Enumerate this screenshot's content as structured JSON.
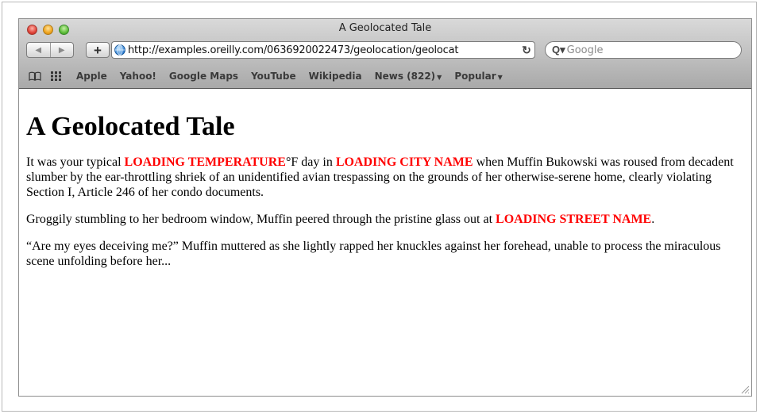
{
  "window": {
    "title": "A Geolocated Tale"
  },
  "toolbar": {
    "back_label": "◀",
    "forward_label": "▶",
    "add_bookmark_label": "+",
    "address_url": "http://examples.oreilly.com/0636920022473/geolocation/geolocat",
    "reload_label": "↻",
    "search_icon_label": "Q▾",
    "search_placeholder": "Google"
  },
  "bookmarks": {
    "items": [
      {
        "label": "Apple"
      },
      {
        "label": "Yahoo!"
      },
      {
        "label": "Google Maps"
      },
      {
        "label": "YouTube"
      },
      {
        "label": "Wikipedia"
      },
      {
        "label": "News (822)"
      },
      {
        "label": "Popular"
      }
    ]
  },
  "page": {
    "heading": "A Geolocated Tale",
    "p1": {
      "t1": "It was your typical ",
      "temp": "LOADING TEMPERATURE",
      "t2": "°F day in ",
      "city": "LOADING CITY NAME",
      "t3": " when Muffin Bukowski was roused from decadent slumber by the ear-throttling shriek of an unidentified avian trespassing on the grounds of her otherwise-serene home, clearly violating Section I, Article 246 of her condo documents."
    },
    "p2": {
      "t1": "Groggily stumbling to her bedroom window, Muffin peered through the pristine glass out at ",
      "street": "LOADING STREET NAME",
      "t2": "."
    },
    "p3": {
      "t1": "“Are my eyes deceiving me?” Muffin muttered as she lightly rapped her knuckles against her forehead, unable to process the miraculous scene unfolding before her..."
    }
  },
  "colors": {
    "loading_text": "#ff0000"
  }
}
